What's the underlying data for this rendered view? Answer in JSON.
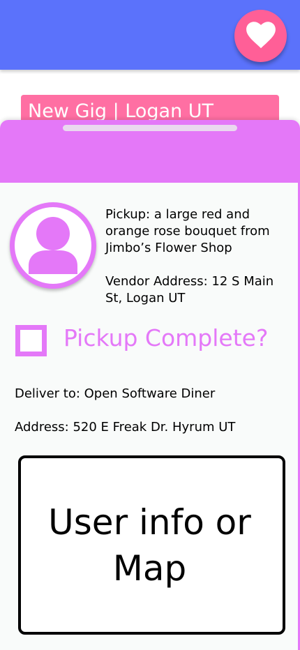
{
  "header": {
    "favorite_icon": "heart-icon",
    "background_color": "#5b72fb",
    "favorite_button_color": "#ff5f97"
  },
  "gig": {
    "title": "New Gig | Logan UT",
    "banner_color": "#ff6fa3"
  },
  "sheet": {
    "accent_color": "#e478f8",
    "avatar_icon": "user-icon",
    "pickup_text": "Pickup: a large red and orange rose bouquet from Jimbo’s Flower Shop",
    "vendor_text": "Vendor Address: 12 S Main St, Logan UT",
    "pickup_complete_label": "Pickup Complete?",
    "pickup_complete_checked": false,
    "deliver_to_text": "Deliver to: Open Software Diner",
    "deliver_address_text": "Address: 520 E Freak Dr.  Hyrum UT",
    "info_placeholder": "User info or Map"
  }
}
